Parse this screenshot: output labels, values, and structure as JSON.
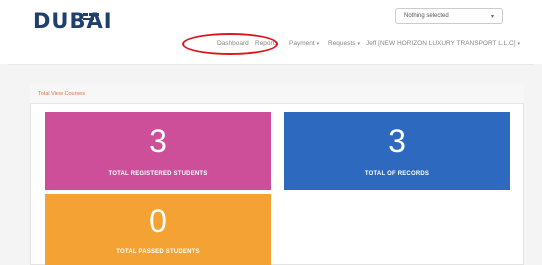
{
  "header": {
    "logo_text": "DUBAI",
    "select_value": "Nothing selected"
  },
  "nav": {
    "dashboard": "Dashboard",
    "reports": "Reports",
    "payment": "Payment",
    "requests": "Requests",
    "user": "Jeff [NEW HORIZON LUXURY TRANSPORT L.L.C]"
  },
  "panel": {
    "title": "Total View Courses"
  },
  "cards": [
    {
      "value": "3",
      "label": "TOTAL REGISTERED STUDENTS",
      "color": "#cd4f99"
    },
    {
      "value": "3",
      "label": "TOTAL OF RECORDS",
      "color": "#2c69bf"
    },
    {
      "value": "0",
      "label": "TOTAL PASSED STUDENTS",
      "color": "#f4a234"
    }
  ],
  "colors": {
    "annotation": "#e0141b",
    "brand": "#1f3f6e",
    "panel_title": "#e2713a"
  }
}
